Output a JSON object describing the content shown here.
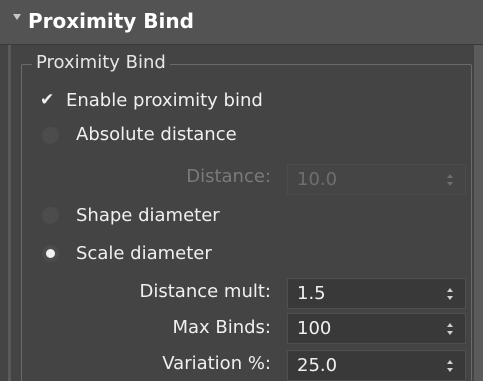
{
  "rollout": {
    "title": "Proximity Bind",
    "collapsed": false
  },
  "group": {
    "title": "Proximity Bind"
  },
  "enable_checkbox": {
    "label": "Enable proximity bind",
    "checked": true
  },
  "options": {
    "absolute_distance": {
      "label": "Absolute distance",
      "selected": false
    },
    "distance": {
      "label": "Distance:",
      "value": "10.0",
      "enabled": false
    },
    "shape_diameter": {
      "label": "Shape diameter",
      "selected": false
    },
    "scale_diameter": {
      "label": "Scale diameter",
      "selected": true
    },
    "distance_mult": {
      "label": "Distance mult:",
      "value": "1.5",
      "enabled": true
    },
    "max_binds": {
      "label": "Max Binds:",
      "value": "100",
      "enabled": true
    },
    "variation": {
      "label": "Variation %:",
      "value": "25.0",
      "enabled": true
    }
  },
  "colors": {
    "panel_background": "#444444",
    "header_background": "#535353",
    "field_background": "#393939",
    "text": "#f0f0f0",
    "disabled_text": "#7a7a7a"
  },
  "icons": {
    "collapse": "triangle-down",
    "check": "checkmark",
    "spinner": "up-down-arrows"
  }
}
